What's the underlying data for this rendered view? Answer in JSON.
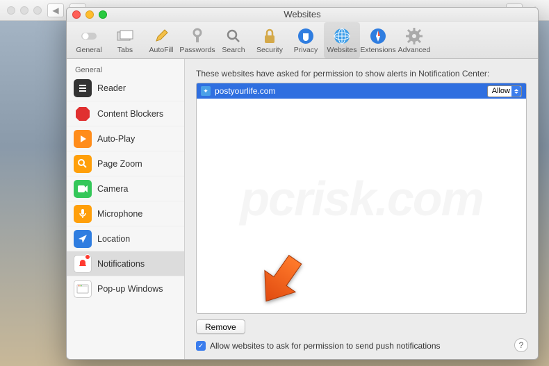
{
  "window_title": "Websites",
  "toolbar": [
    {
      "id": "general",
      "label": "General"
    },
    {
      "id": "tabs",
      "label": "Tabs"
    },
    {
      "id": "autofill",
      "label": "AutoFill"
    },
    {
      "id": "passwords",
      "label": "Passwords"
    },
    {
      "id": "search",
      "label": "Search"
    },
    {
      "id": "security",
      "label": "Security"
    },
    {
      "id": "privacy",
      "label": "Privacy"
    },
    {
      "id": "websites",
      "label": "Websites"
    },
    {
      "id": "extensions",
      "label": "Extensions"
    },
    {
      "id": "advanced",
      "label": "Advanced"
    }
  ],
  "toolbar_selected": "websites",
  "sidebar": {
    "header": "General",
    "items": [
      {
        "id": "reader",
        "label": "Reader"
      },
      {
        "id": "content-blockers",
        "label": "Content Blockers"
      },
      {
        "id": "auto-play",
        "label": "Auto-Play"
      },
      {
        "id": "page-zoom",
        "label": "Page Zoom"
      },
      {
        "id": "camera",
        "label": "Camera"
      },
      {
        "id": "microphone",
        "label": "Microphone"
      },
      {
        "id": "location",
        "label": "Location"
      },
      {
        "id": "notifications",
        "label": "Notifications",
        "badge": true
      },
      {
        "id": "popup-windows",
        "label": "Pop-up Windows"
      }
    ],
    "selected": "notifications"
  },
  "main": {
    "description": "These websites have asked for permission to show alerts in Notification Center:",
    "rows": [
      {
        "site": "postyourlife.com",
        "permission": "Allow"
      }
    ],
    "remove_label": "Remove",
    "checkbox_checked": true,
    "checkbox_label": "Allow websites to ask for permission to send push notifications"
  },
  "help_label": "?",
  "watermark": "pcrisk.com"
}
